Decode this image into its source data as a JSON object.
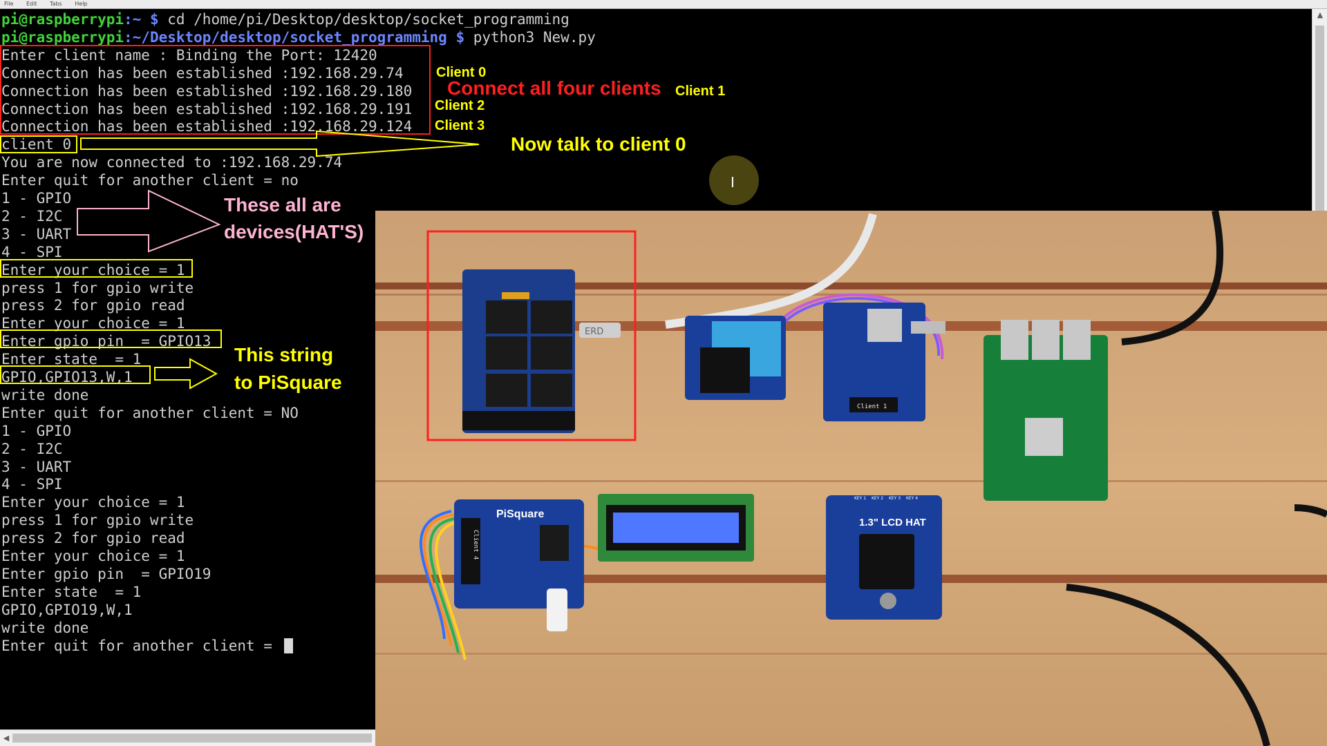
{
  "menu": [
    "File",
    "Edit",
    "Tabs",
    "Help"
  ],
  "terminal": {
    "lines": [
      {
        "user": "pi@raspberrypi",
        "path": ":~ $",
        "cmd": " cd /home/pi/Desktop/desktop/socket_programming"
      },
      {
        "user": "pi@raspberrypi",
        "path": ":~/Desktop/desktop/socket_programming $",
        "cmd": " python3 New.py"
      },
      {
        "text": "Enter client name : Binding the Port: 12420"
      },
      {
        "text": "Connection has been established :192.168.29.74"
      },
      {
        "text": "Connection has been established :192.168.29.180"
      },
      {
        "text": "Connection has been established :192.168.29.191"
      },
      {
        "text": "Connection has been established :192.168.29.124"
      },
      {
        "text": "client 0"
      },
      {
        "text": "You are now connected to :192.168.29.74"
      },
      {
        "text": "Enter quit for another client = no"
      },
      {
        "text": "1 - GPIO"
      },
      {
        "text": "2 - I2C"
      },
      {
        "text": "3 - UART"
      },
      {
        "text": "4 - SPI"
      },
      {
        "text": "Enter your choice = 1"
      },
      {
        "text": "press 1 for gpio write"
      },
      {
        "text": "press 2 for gpio read"
      },
      {
        "text": "Enter your choice = 1"
      },
      {
        "text": "Enter gpio pin  = GPIO13"
      },
      {
        "text": "Enter state  = 1"
      },
      {
        "text": "GPIO,GPIO13,W,1"
      },
      {
        "text": "write done"
      },
      {
        "text": "Enter quit for another client = NO"
      },
      {
        "text": "1 - GPIO"
      },
      {
        "text": "2 - I2C"
      },
      {
        "text": "3 - UART"
      },
      {
        "text": "4 - SPI"
      },
      {
        "text": "Enter your choice = 1"
      },
      {
        "text": "press 1 for gpio write"
      },
      {
        "text": "press 2 for gpio read"
      },
      {
        "text": "Enter your choice = 1"
      },
      {
        "text": "Enter gpio pin  = GPIO19"
      },
      {
        "text": "Enter state  = 1"
      },
      {
        "text": "GPIO,GPIO19,W,1"
      },
      {
        "text": "write done"
      },
      {
        "text": "Enter quit for another client = "
      }
    ]
  },
  "annotations": {
    "client0": "Client 0",
    "client1": "Client 1",
    "client2": "Client 2",
    "client3": "Client 3",
    "connect_all": "Connect all four clients",
    "talk_client0": "Now talk to client 0",
    "devices_line1": "These all are",
    "devices_line2": "devices(HAT'S)",
    "string_line1": "This string",
    "string_line2": "to PiSquare"
  },
  "photo": {
    "pisquare_label": "PiSquare",
    "lcd_hat_label": "1.3\" LCD HAT",
    "relay_plug": "ERD",
    "oled_client1": "Client 1",
    "oled_client4": "Client 4",
    "key_labels": [
      "KEY 1",
      "KEY 2",
      "KEY 3",
      "KEY 4"
    ]
  },
  "colors": {
    "prompt_user": "#3fd33a",
    "prompt_path": "#6b86ff",
    "terminal_text": "#cfcfcf",
    "red_annotation": "#ff1f1f",
    "yellow_annotation": "#ffff00",
    "pink_annotation": "#ffb3d2",
    "board_blue": "#1d46b8"
  }
}
